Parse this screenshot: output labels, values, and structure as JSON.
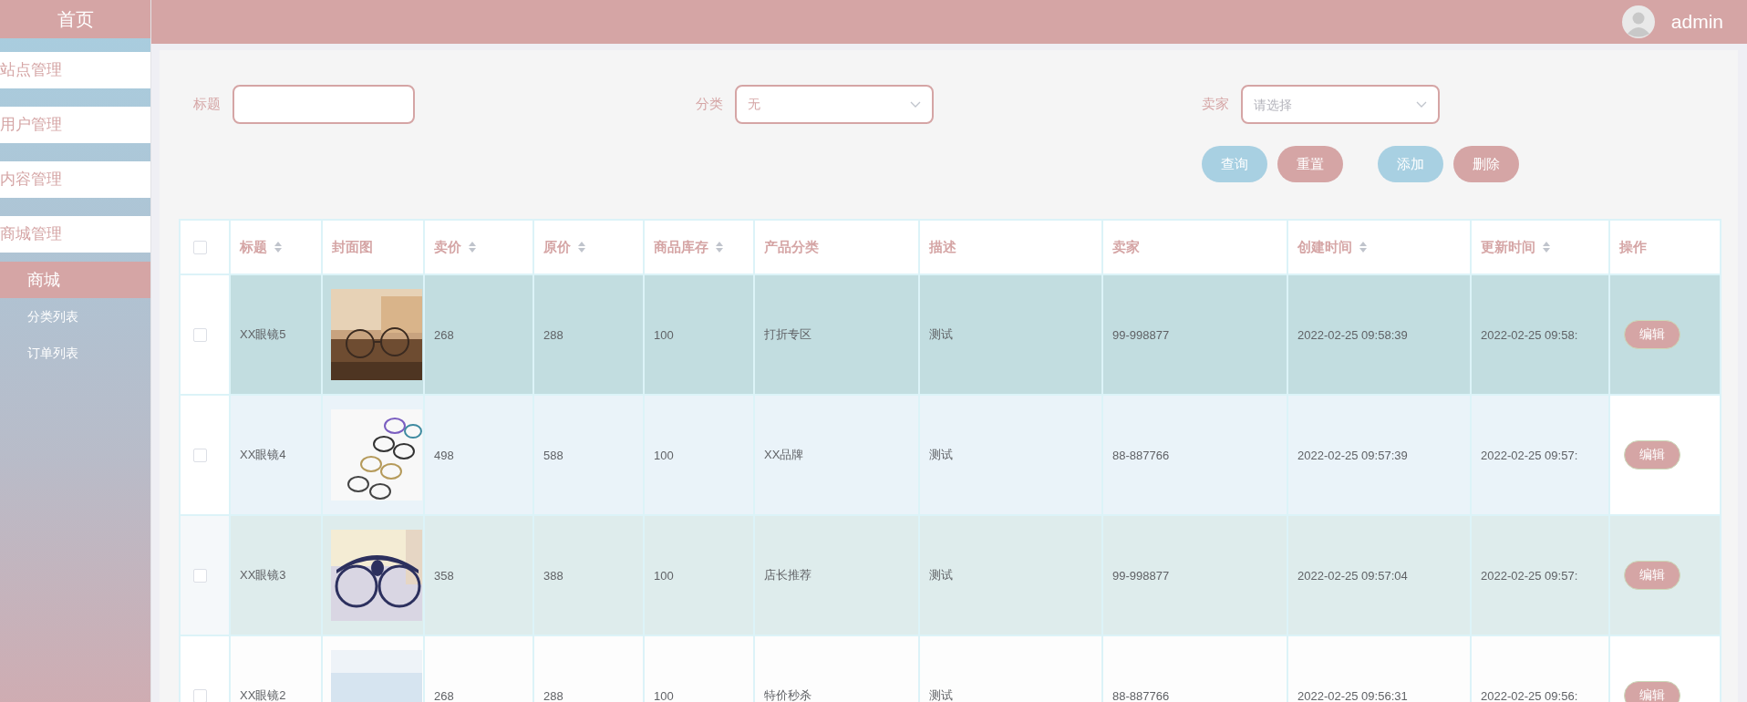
{
  "topbar": {
    "username": "admin"
  },
  "sidebar": {
    "home": "首页",
    "menus": [
      {
        "label": "站点管理"
      },
      {
        "label": "用户管理"
      },
      {
        "label": "内容管理"
      },
      {
        "label": "商城管理"
      }
    ],
    "submenu": {
      "title": "商城",
      "items": [
        {
          "label": "分类列表"
        },
        {
          "label": "订单列表"
        }
      ]
    }
  },
  "filters": [
    {
      "kind": "input",
      "label": "标题"
    },
    {
      "kind": "select",
      "label": "分类",
      "value": "无"
    },
    {
      "kind": "select",
      "label": "卖家",
      "placeholder": "请选择"
    }
  ],
  "button_groups": [
    [
      {
        "label": "查询",
        "kind": "primary"
      },
      {
        "label": "重置",
        "kind": "danger"
      }
    ],
    [
      {
        "label": "添加",
        "kind": "primary"
      },
      {
        "label": "删除",
        "kind": "danger"
      }
    ]
  ],
  "table": {
    "select_all": {
      "checked": false
    },
    "columns": [
      {
        "label": "标题",
        "kind": "text",
        "sortable": true
      },
      {
        "label": "封面图",
        "kind": "picture",
        "sortable": false
      },
      {
        "label": "卖价",
        "kind": "text",
        "sortable": true
      },
      {
        "label": "原价",
        "kind": "text",
        "sortable": true
      },
      {
        "label": "商品库存",
        "kind": "text",
        "sortable": true
      },
      {
        "label": "产品分类",
        "kind": "text",
        "sortable": false
      },
      {
        "label": "描述",
        "kind": "text",
        "sortable": false
      },
      {
        "label": "卖家",
        "kind": "text",
        "sortable": false
      },
      {
        "label": "创建时间",
        "kind": "text",
        "sortable": true
      },
      {
        "label": "更新时间",
        "kind": "text",
        "sortable": true
      },
      {
        "label": "操作",
        "kind": "action",
        "sortable": false
      }
    ],
    "rows": [
      {
        "checked": false,
        "selected": true,
        "hovered": false,
        "cells": [
          "XX眼镜5",
          {
            "kind": "picture"
          },
          "268",
          "288",
          "100",
          "打折专区",
          "测试",
          "99-998877",
          "2022-02-25 09:58:39",
          "2022-02-25 09:58:",
          "编辑"
        ]
      },
      {
        "checked": false,
        "selected": false,
        "hovered": true,
        "cells": [
          "XX眼镜4",
          {
            "kind": "picture"
          },
          "498",
          "588",
          "100",
          "XX品牌",
          "测试",
          "88-887766",
          "2022-02-25 09:57:39",
          "2022-02-25 09:57:",
          "编辑"
        ]
      },
      {
        "checked": false,
        "selected": false,
        "hovered": false,
        "cells": [
          "XX眼镜3",
          {
            "kind": "picture"
          },
          "358",
          "388",
          "100",
          "店长推荐",
          "测试",
          "99-998877",
          "2022-02-25 09:57:04",
          "2022-02-25 09:57:",
          "编辑"
        ]
      },
      {
        "checked": false,
        "selected": false,
        "hovered": false,
        "cells": [
          "XX眼镜2",
          {
            "kind": "picture"
          },
          "268",
          "288",
          "100",
          "特价秒杀",
          "测试",
          "88-887766",
          "2022-02-25 09:56:31",
          "2022-02-25 09:56:",
          "编辑"
        ]
      }
    ]
  }
}
